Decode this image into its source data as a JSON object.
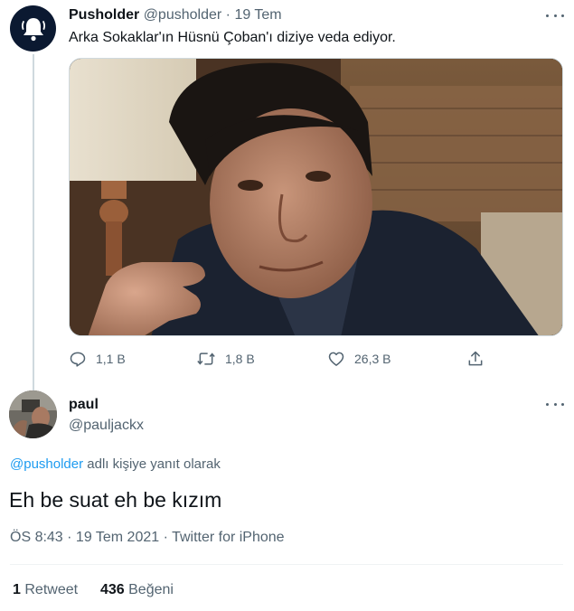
{
  "tweet1": {
    "display_name": "Pusholder",
    "handle": "@pusholder",
    "separator": "·",
    "date": "19 Tem",
    "text": "Arka Sokaklar'ın Hüsnü Çoban'ı diziye veda ediyor.",
    "avatar_icon": "bell-icon",
    "actions": {
      "replies": "1,1 B",
      "retweets": "1,8 B",
      "likes": "26,3 B"
    }
  },
  "tweet2": {
    "display_name": "paul",
    "handle": "@pauljackx",
    "reply_to_handle": "@pusholder",
    "reply_to_suffix": "adlı kişiye yanıt olarak",
    "text": "Eh be suat eh be kızım",
    "meta": "ÖS 8:43 · 19 Tem 2021 · Twitter for iPhone",
    "retweet_count": "1",
    "retweet_label": "Retweet",
    "like_count": "436",
    "like_label": "Beğeni"
  },
  "colors": {
    "link": "#1d9bf0",
    "muted": "#536471",
    "text": "#0f1419",
    "thread_line": "#cfd9de"
  }
}
